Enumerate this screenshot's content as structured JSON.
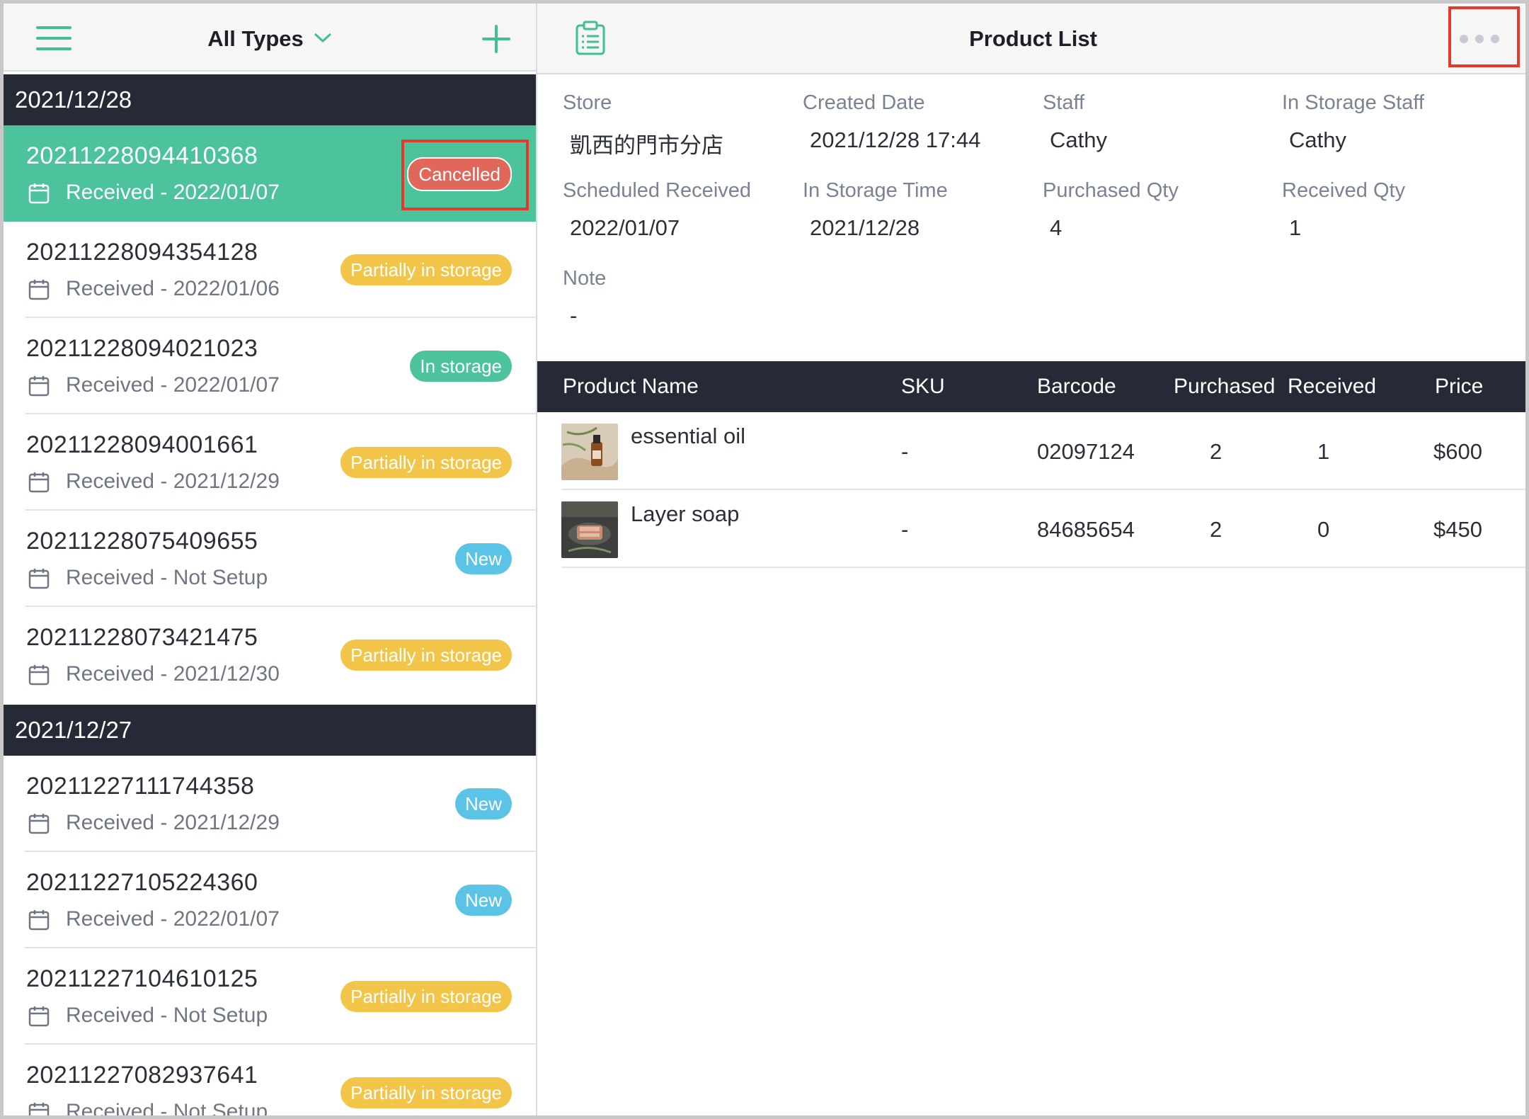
{
  "left": {
    "filter_label": "All Types",
    "groups": [
      {
        "date": "2021/12/28",
        "orders": [
          {
            "number": "20211228094410368",
            "received": "Received - 2022/01/07",
            "status": "Cancelled",
            "selected": true
          },
          {
            "number": "20211228094354128",
            "received": "Received - 2022/01/06",
            "status": "Partially in storage"
          },
          {
            "number": "20211228094021023",
            "received": "Received - 2022/01/07",
            "status": "In storage"
          },
          {
            "number": "20211228094001661",
            "received": "Received - 2021/12/29",
            "status": "Partially in storage"
          },
          {
            "number": "20211228075409655",
            "received": "Received - Not Setup",
            "status": "New"
          },
          {
            "number": "20211228073421475",
            "received": "Received - 2021/12/30",
            "status": "Partially in storage"
          }
        ]
      },
      {
        "date": "2021/12/27",
        "orders": [
          {
            "number": "20211227111744358",
            "received": "Received - 2021/12/29",
            "status": "New"
          },
          {
            "number": "20211227105224360",
            "received": "Received - 2022/01/07",
            "status": "New"
          },
          {
            "number": "20211227104610125",
            "received": "Received - Not Setup",
            "status": "Partially in storage"
          },
          {
            "number": "20211227082937641",
            "received": "Received - Not Setup",
            "status": "Partially in storage"
          }
        ]
      }
    ]
  },
  "right": {
    "title": "Product List",
    "details": {
      "store_label": "Store",
      "store": "凱西的門市分店",
      "created_label": "Created Date",
      "created": "2021/12/28 17:44",
      "staff_label": "Staff",
      "staff": "Cathy",
      "storage_staff_label": "In Storage Staff",
      "storage_staff": "Cathy",
      "scheduled_label": "Scheduled Received",
      "scheduled": "2022/01/07",
      "storage_time_label": "In Storage Time",
      "storage_time": "2021/12/28",
      "purchased_qty_label": "Purchased Qty",
      "purchased_qty": "4",
      "received_qty_label": "Received Qty",
      "received_qty": "1",
      "note_label": "Note",
      "note": "-"
    },
    "table": {
      "headers": [
        "Product Name",
        "SKU",
        "Barcode",
        "Purchased",
        "Received",
        "Price"
      ],
      "rows": [
        {
          "name": "essential oil",
          "sku": "-",
          "barcode": "02097124",
          "purchased": "2",
          "received": "1",
          "price": "$600"
        },
        {
          "name": "Layer soap",
          "sku": "-",
          "barcode": "84685654",
          "purchased": "2",
          "received": "0",
          "price": "$450"
        }
      ]
    }
  },
  "colors": {
    "accent": "#3fbf93",
    "selected_row": "#4cc39d",
    "header_dark": "#252a36",
    "badge_partial": "#f2c548",
    "badge_in_storage": "#4cc39d",
    "badge_new": "#5bc4e6",
    "badge_cancelled": "#e0675a",
    "highlight_box": "#e23a2b"
  },
  "icons": [
    "menu-icon",
    "chevron-down-icon",
    "plus-icon",
    "calendar-icon",
    "clipboard-icon",
    "more-icon"
  ]
}
